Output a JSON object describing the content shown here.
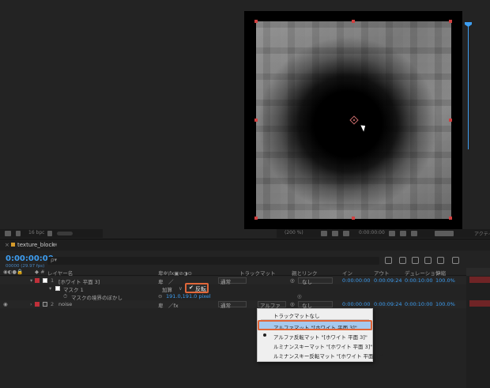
{
  "panel_tab": {
    "name": "texture_block"
  },
  "timeline": {
    "timecode": "0:00:00:00",
    "fps": "00000 (29.97 fps)",
    "search_placeholder": "ρ▾"
  },
  "columns": {
    "layer_name": "レイヤー名",
    "switches": "卑✲\\fx▣⊘◑⊙",
    "track_matte": "トラックマット",
    "parent": "親とリンク",
    "in": "イン",
    "out": "アウト",
    "duration": "デュレーション",
    "stretch": "伸縮"
  },
  "layers": [
    {
      "number": "1",
      "name": "[ホワイト 平面 3]",
      "label_color": "#c0303a",
      "mode": "通常",
      "parent": "なし",
      "in": "0:00:00:00",
      "out": "0:00:09:24",
      "duration": "0:00:10:00",
      "stretch": "100.0%"
    },
    {
      "number": "2",
      "name": "noise",
      "label_color": "#c0303a",
      "mode": "通常",
      "matte": "アルファ",
      "parent": "なし",
      "in": "0:00:00:00",
      "out": "0:00:09:24",
      "duration": "0:00:10:00",
      "stretch": "100.0%"
    }
  ],
  "mask": {
    "name": "マスク 1",
    "mode": "加算",
    "invert_label": "反転",
    "feather_label": "マスクの境界のぼかし",
    "feather_value": "191.0,191.0 pixel"
  },
  "viewer_bar": {
    "bpc": "16 bpc",
    "zoom": "(200 %)",
    "time": "0:00:00:00",
    "extra": "アクティ"
  },
  "matte_menu": {
    "items": [
      "トラックマットなし",
      "アルファマット \"[ホワイト 平面 3]\"",
      "アルファ反転マット \"[ホワイト 平面 3]\"",
      "ルミナンスキーマット \"[ホワイト 平面 3]\"",
      "ルミナンスキー反転マット \"[ホワイト 平面 3]\""
    ],
    "highlighted_index": 1,
    "selected_index": 2
  },
  "colors": {
    "accent": "#3d9df0",
    "highlight_box": "#e0673a",
    "layer_label": "#c0303a"
  }
}
